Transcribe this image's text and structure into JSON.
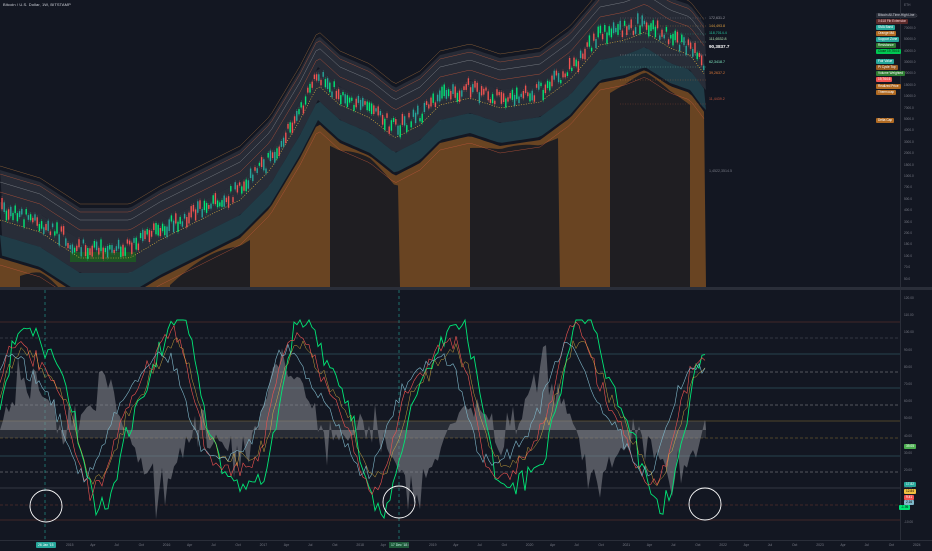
{
  "chart": {
    "title": "Bitcoin / U.S. Dollar, 1W, BITSTAMP",
    "colors": {
      "background": "#131722",
      "up": "#26a69a",
      "up_bright": "#00e676",
      "down": "#ef5350",
      "band_orange": "#b06a22",
      "band_teal": "#2a5560",
      "band_gray": "#3a3f4b",
      "osc_fill": "#8a8d94",
      "osc_green": "#00e676",
      "osc_red": "#ef5350",
      "osc_blue": "#7fb7c9",
      "osc_yellow": "#f0c040"
    },
    "price_axis_ticks": [
      "ETH",
      "120000.0",
      "70000.0",
      "50000.0",
      "40000.0",
      "30000.0",
      "20000.0",
      "15000.0",
      "10000.0",
      "7000.0",
      "5000.0",
      "4000.0",
      "3000.0",
      "2000.0",
      "1500.0",
      "1000.0",
      "700.0",
      "500.0",
      "400.0",
      "300.0",
      "200.0",
      "150.0",
      "100.0",
      "70.0",
      "50.0"
    ],
    "level_labels": [
      {
        "text": "172,631.2",
        "color": "#9e9ea8"
      },
      {
        "text": "144,493.8",
        "color": "#e0a040"
      },
      {
        "text": "118,7014.4",
        "color": "#26c6a0"
      },
      {
        "text": "111,6532.8",
        "color": "#b0e0b0"
      },
      {
        "text": "90,3837.7",
        "color": "#ffffff"
      },
      {
        "text": "62,3418.7",
        "color": "#80e8c0"
      },
      {
        "text": "39,2637.2",
        "color": "#e07b39"
      },
      {
        "text": "11,4439.2",
        "color": "#c0553a"
      },
      {
        "text": "1,4522,3514.5",
        "color": "#787b86"
      }
    ],
    "right_tags": [
      {
        "text": "Bitcoin All-Time-High Line",
        "bg": "#2a2e39",
        "fg": "#d1d4dc"
      },
      {
        "text": "0.618 Fib Extension",
        "bg": "#5b2a2a",
        "fg": "#ffcdd2"
      },
      {
        "text": "SMA Band",
        "bg": "#26a69a",
        "fg": "#ffffff"
      },
      {
        "text": "Orange MA",
        "bg": "#b06a22",
        "fg": "#ffffff"
      },
      {
        "text": "Support Zone",
        "bg": "#26a69a",
        "fg": "#ffffff"
      },
      {
        "text": "Resistance",
        "bg": "#2e7d32",
        "fg": "#ffffff"
      },
      {
        "text": "Close 19,764.6",
        "bg": "#00c853",
        "fg": "#0b1a0f"
      },
      {
        "text": "Fair Value",
        "bg": "#26a69a",
        "fg": "#ffffff"
      },
      {
        "text": "Pi Cycle Top",
        "bg": "#9a5a20",
        "fg": "#ffffff"
      },
      {
        "text": "Volume Weighted",
        "bg": "#2e7d32",
        "fg": "#ffffff"
      },
      {
        "text": "19,764.6",
        "bg": "#ef5350",
        "fg": "#ffffff"
      },
      {
        "text": "Realized Price",
        "bg": "#b06a22",
        "fg": "#ffffff"
      },
      {
        "text": "Thermocap",
        "bg": "#b06a22",
        "fg": "#ffffff"
      },
      {
        "text": "Delta Cap",
        "bg": "#b06a22",
        "fg": "#ffffff"
      }
    ],
    "osc_axis_ticks": [
      "120.00",
      "110.00",
      "100.00",
      "90.00",
      "80.00",
      "70.00",
      "60.00",
      "50.00",
      "40.00",
      "30.00",
      "20.00",
      "10.00",
      "0.00",
      "-10.00"
    ],
    "osc_tags": [
      {
        "text": "39.05",
        "bg": "#4caf50",
        "fg": "#fff"
      },
      {
        "text": "17.82",
        "bg": "#26a69a",
        "fg": "#fff"
      },
      {
        "text": "12.84",
        "bg": "#f0c040",
        "fg": "#000"
      },
      {
        "text": "9.41",
        "bg": "#ef5350",
        "fg": "#fff"
      },
      {
        "text": "2.16",
        "bg": "#7fb7c9",
        "fg": "#000"
      },
      {
        "text": "-1.95",
        "bg": "#00e676",
        "fg": "#000"
      }
    ],
    "time_axis": {
      "highlight_left": "26 Jan '15",
      "highlight_mid": "17 Dec '18",
      "ticks": [
        "2015",
        "Apr",
        "Jul",
        "Oct",
        "2016",
        "Apr",
        "Jul",
        "Oct",
        "2017",
        "Apr",
        "Jul",
        "Oct",
        "2018",
        "Apr",
        "Jul",
        "2019",
        "Apr",
        "Jul",
        "Oct",
        "2020",
        "Apr",
        "Jul",
        "Oct",
        "2021",
        "Apr",
        "Jul",
        "Oct",
        "2022",
        "Apr",
        "Jul",
        "Oct",
        "2023",
        "Apr",
        "Jul",
        "Oct",
        "2024"
      ]
    }
  }
}
